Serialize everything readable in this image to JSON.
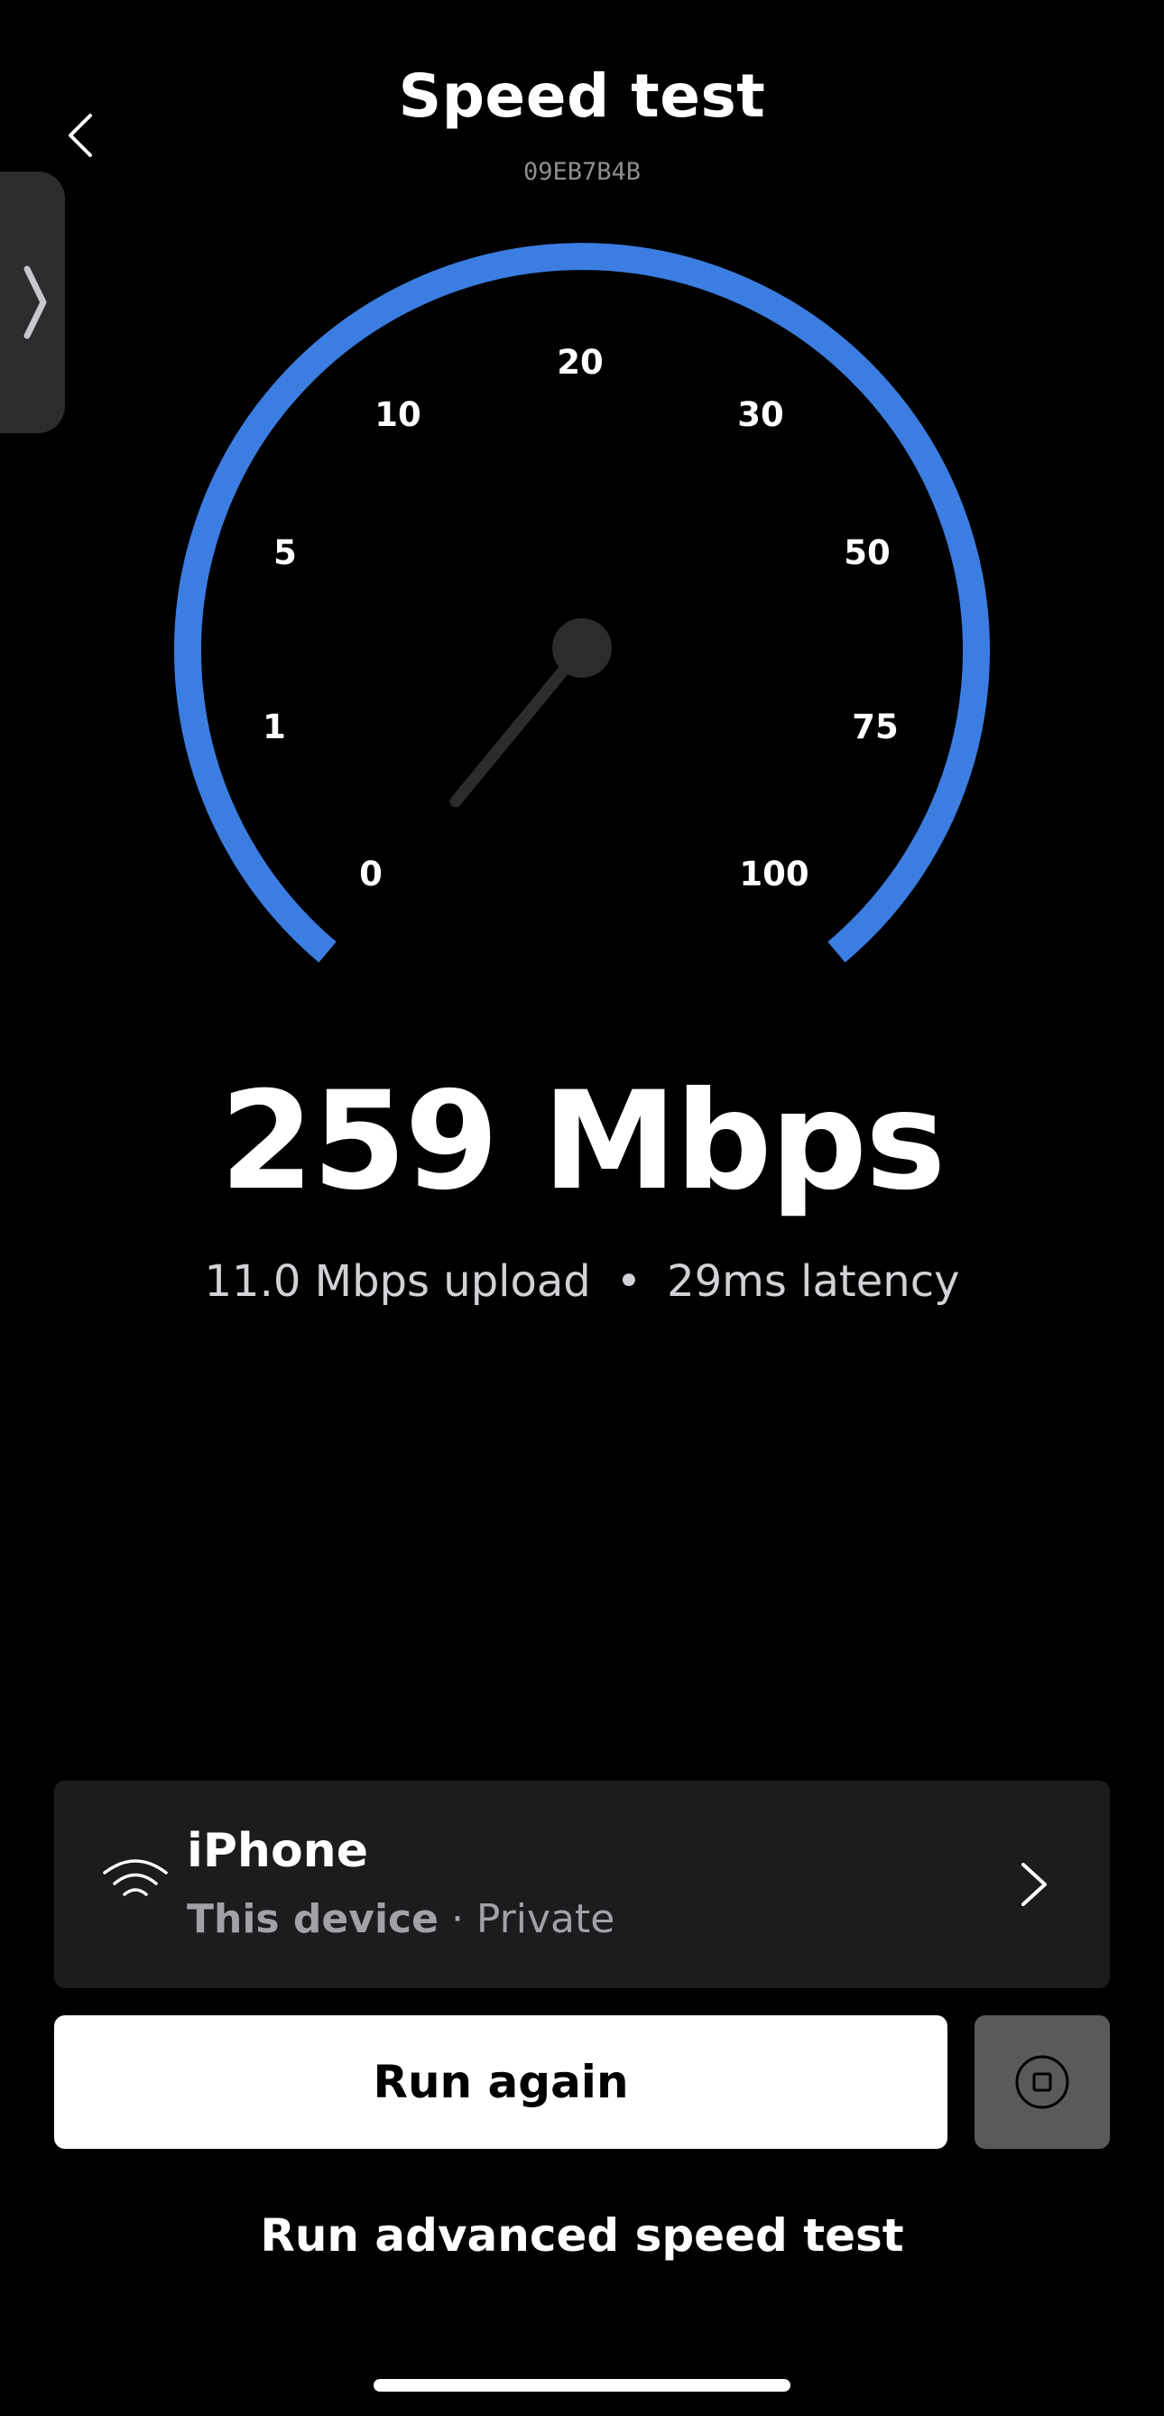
{
  "header": {
    "title": "Speed test",
    "device_code": "09EB7B4B"
  },
  "icons": {
    "back": "chevron-left-icon",
    "side_tab": "chevron-right-icon",
    "wifi": "wifi-icon",
    "device_chevron": "chevron-right-icon",
    "stop": "stop-icon"
  },
  "gauge": {
    "ticks": [
      "0",
      "1",
      "5",
      "10",
      "20",
      "30",
      "50",
      "75",
      "100"
    ],
    "arc_color": "#3b7de1",
    "needle_color": "#2c2c2e"
  },
  "result": {
    "download": "259 Mbps",
    "upload": "11.0 Mbps upload",
    "separator": "•",
    "latency": "29ms latency"
  },
  "device": {
    "name": "iPhone",
    "type": "This device",
    "separator": " · ",
    "network": "Private"
  },
  "actions": {
    "run_again": "Run again",
    "advanced": "Run advanced speed test"
  }
}
